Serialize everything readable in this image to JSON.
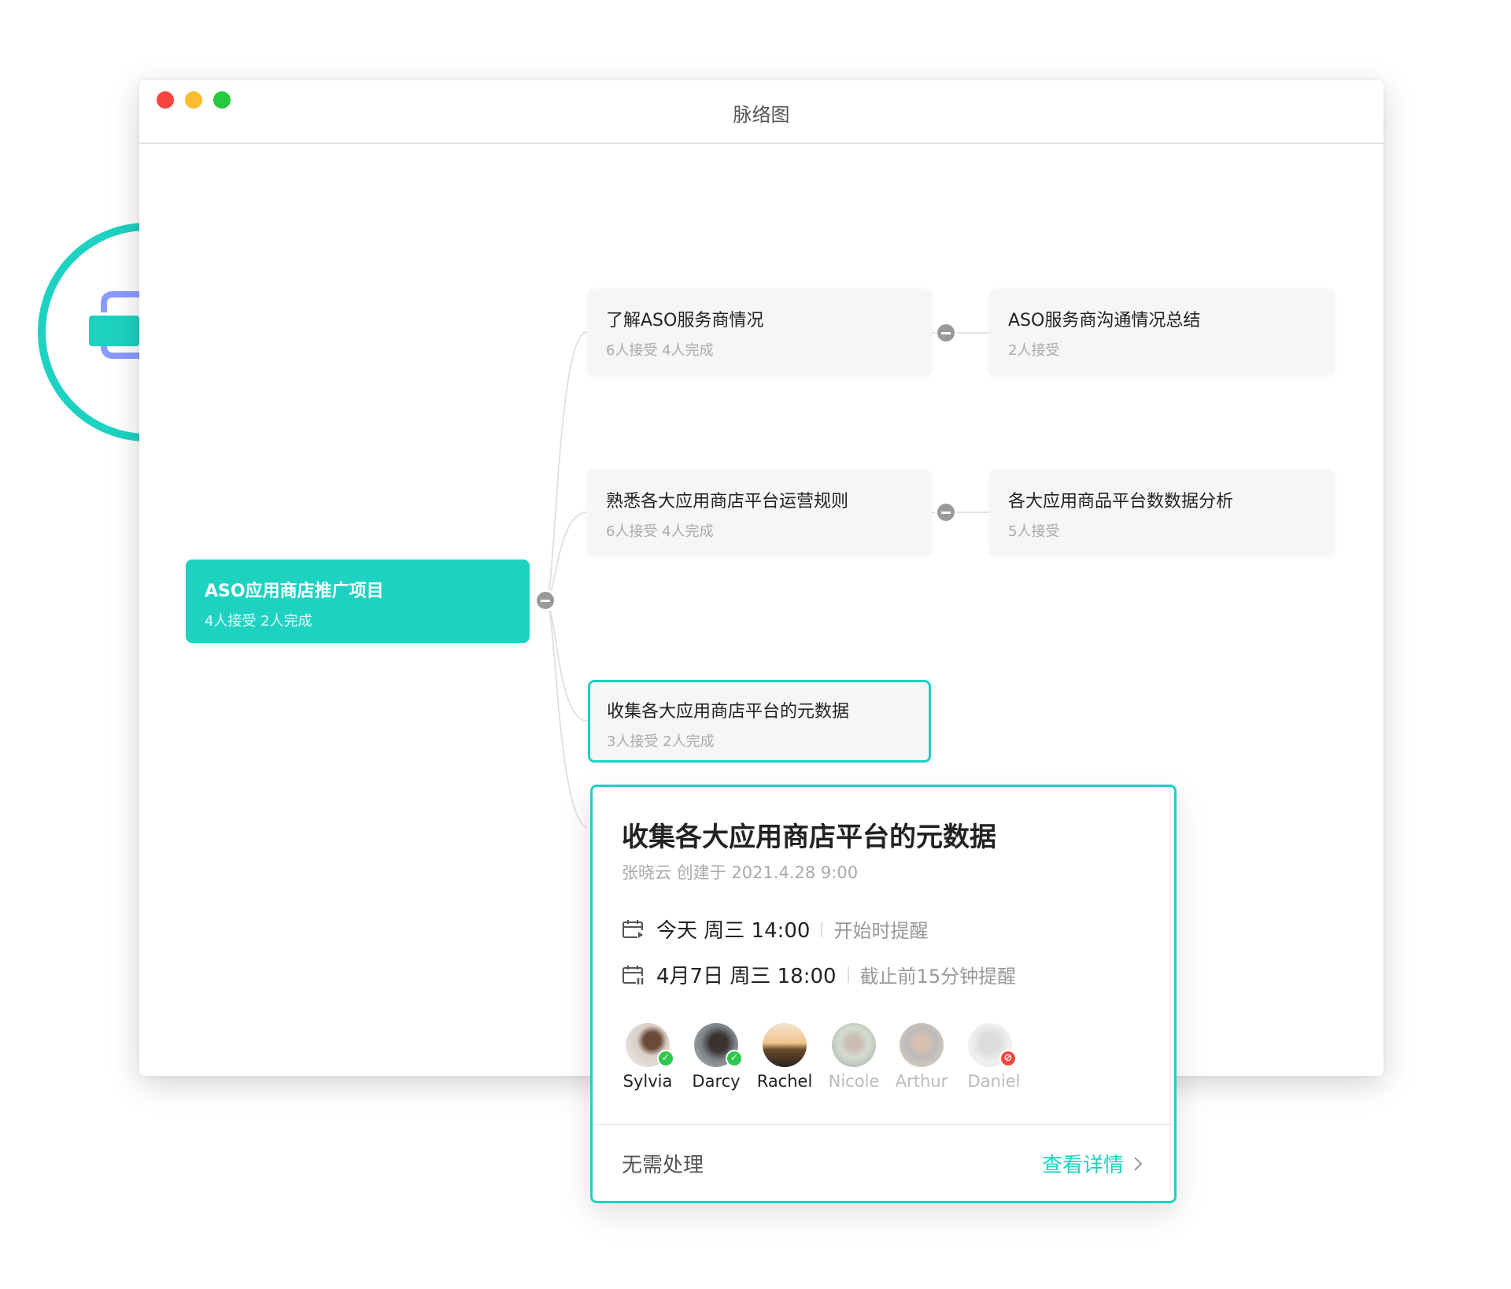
{
  "window": {
    "title": "脉络图",
    "traffic_lights": [
      "#f5453f",
      "#fbbd2e",
      "#27c93f"
    ]
  },
  "colors": {
    "accent": "#1ed2c2",
    "connector_icon": "#8a9bff"
  },
  "app_icon": "mind-map-collapse-expand-icon",
  "root": {
    "title": "ASO应用商店推广项目",
    "stats": "4人接受 2人完成"
  },
  "nodes": [
    {
      "title": "了解ASO服务商情况",
      "stats": "6人接受 4人完成"
    },
    {
      "title": "ASO服务商沟通情况总结",
      "stats": "2人接受"
    },
    {
      "title": "熟悉各大应用商店平台运营规则",
      "stats": "6人接受 4人完成"
    },
    {
      "title": "各大应用商品平台数数据分析",
      "stats": "5人接受"
    },
    {
      "title": "收集各大应用商店平台的元数据",
      "stats": "3人接受 2人完成"
    }
  ],
  "popup": {
    "title": "收集各大应用商店平台的元数据",
    "subtitle": "张晓云 创建于 2021.4.28   9:00",
    "start": {
      "time": "今天 周三 14:00",
      "reminder": "开始时提醒"
    },
    "due": {
      "time": "4月7日 周三 18:00",
      "reminder": "截止前15分钟提醒"
    },
    "members": [
      {
        "name": "Sylvia",
        "status": "done"
      },
      {
        "name": "Darcy",
        "status": "done"
      },
      {
        "name": "Rachel",
        "status": "accepted"
      },
      {
        "name": "Nicole",
        "status": "pending"
      },
      {
        "name": "Arthur",
        "status": "pending"
      },
      {
        "name": "Daniel",
        "status": "declined"
      }
    ],
    "footer_left": "无需处理",
    "footer_right": "查看详情"
  }
}
